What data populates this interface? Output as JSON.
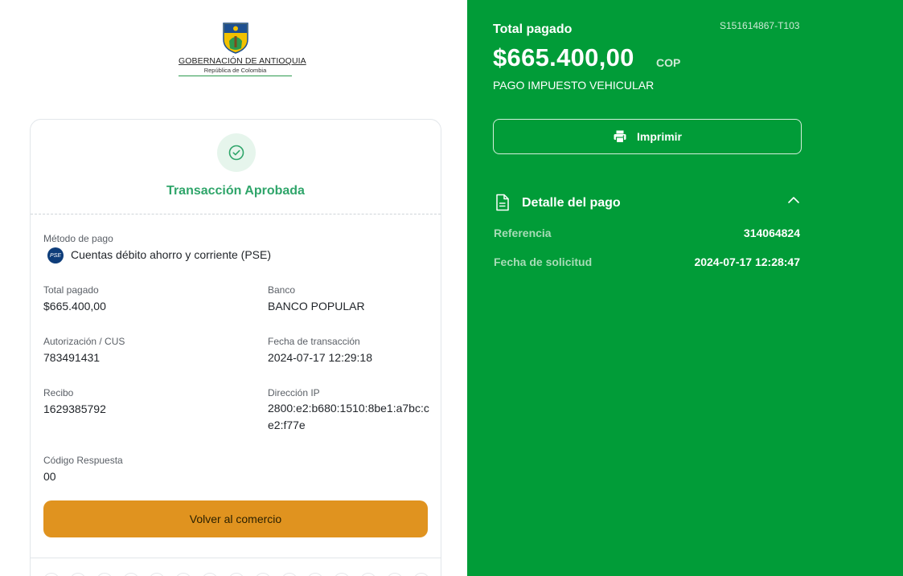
{
  "brand": {
    "name": "GOBERNACIÓN DE ANTIOQUIA",
    "country": "República de Colombia"
  },
  "card": {
    "status_title": "Transacción Aprobada",
    "fields": {
      "payment_method_label": "Método de pago",
      "payment_method_value": "Cuentas débito ahorro y corriente (PSE)",
      "pse_icon_text": "PSE",
      "total_label": "Total pagado",
      "total_value": "$665.400,00",
      "bank_label": "Banco",
      "bank_value": "BANCO POPULAR",
      "auth_label": "Autorización / CUS",
      "auth_value": "783491431",
      "tx_date_label": "Fecha de transacción",
      "tx_date_value": "2024-07-17 12:29:18",
      "receipt_label": "Recibo",
      "receipt_value": "1629385792",
      "ip_label": "Dirección IP",
      "ip_value": "2800:e2:b680:1510:8be1:a7bc:ce2:f77e",
      "response_label": "Código Respuesta",
      "response_value": "00"
    },
    "back_button": "Volver al comercio"
  },
  "summary": {
    "title": "Total pagado",
    "code": "S151614867-T103",
    "amount": "$665.400,00",
    "currency": "COP",
    "concept": "PAGO IMPUESTO VEHICULAR",
    "print_button": "Imprimir",
    "detail_title": "Detalle del pago",
    "detail": [
      {
        "label": "Referencia",
        "value": "314064824"
      },
      {
        "label": "Fecha de solicitud",
        "value": "2024-07-17 12:28:47"
      }
    ]
  },
  "colors": {
    "success_green": "#2fa56a",
    "panel_green": "#019c38",
    "accent_orange": "#e0931f"
  },
  "icons": [
    "coat-of-arms-icon",
    "check-icon",
    "pse-icon",
    "printer-icon",
    "document-icon",
    "chevron-up-icon"
  ]
}
